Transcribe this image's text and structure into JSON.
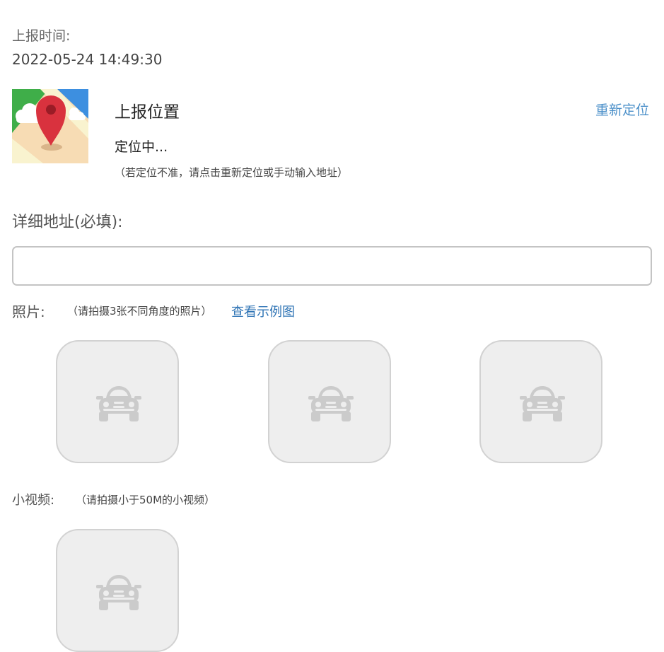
{
  "report_time": {
    "label": "上报时间:",
    "value": "2022-05-24 14:49:30"
  },
  "location": {
    "map_icon": "map-pin-icon",
    "title": "上报位置",
    "status": "定位中...",
    "hint": "（若定位不准，请点击重新定位或手动输入地址）",
    "relocate_label": "重新定位"
  },
  "address": {
    "label": "详细地址(必填):",
    "value": "",
    "placeholder": ""
  },
  "photos": {
    "label": "照片:",
    "hint": "（请拍摄3张不同角度的照片）",
    "example_link": "查看示例图",
    "slot_icon": "car-icon",
    "slot_count": 3
  },
  "video": {
    "label": "小视频:",
    "hint": "（请拍摄小于50M的小视频）",
    "slot_icon": "car-icon",
    "slot_count": 1
  },
  "colors": {
    "link": "#4a8fc9",
    "tile_bg": "#eeeeee",
    "tile_border": "#d2d2d2",
    "icon": "#cbcbcb"
  }
}
